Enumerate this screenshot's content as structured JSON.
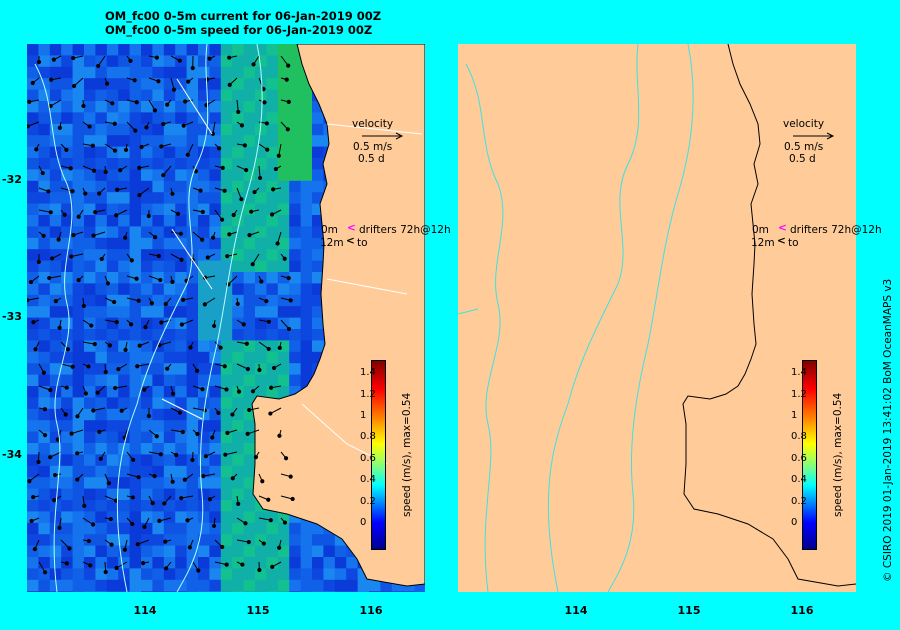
{
  "title_line1": "OM_fc00 0-5m current for 06-Jan-2019 00Z",
  "title_line2": "OM_fc00 0-5m speed for 06-Jan-2019 00Z",
  "y_ticks": [
    "-32",
    "-33",
    "-34"
  ],
  "x_ticks": [
    "114",
    "115",
    "116"
  ],
  "legend": {
    "velocity": "velocity",
    "speed_ref": "0.5 m/s",
    "duration_ref": "0.5 d",
    "drifters_depth": "0m",
    "drifters_label": "drifters 72h@12h",
    "to_depth": "12m",
    "to_label": "to"
  },
  "colorbar": {
    "title": "speed (m/s), max=0.54",
    "ticks": [
      "1.4",
      "1.2",
      "1",
      "0.8",
      "0.6",
      "0.4",
      "0.2",
      "0"
    ]
  },
  "copyright": "© CSIRO 2019   01-Jan-2019 13:41:02 BoM OceanMAPS v3",
  "colors": {
    "background": "#00ffff",
    "land": "#ffcc99",
    "contour": "#40e0e0",
    "drifter_marker": "#ff00ff"
  }
}
